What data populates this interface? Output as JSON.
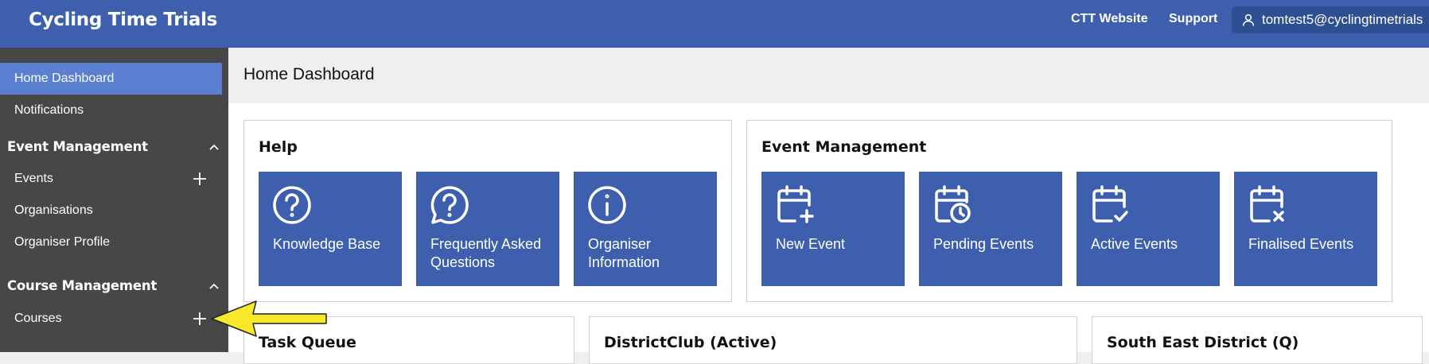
{
  "header": {
    "brand": "Cycling Time Trials",
    "links": [
      "CTT Website",
      "Support"
    ],
    "user_email": "tomtest5@cyclingtimetrials"
  },
  "sidebar": {
    "home": "Home Dashboard",
    "notifications": "Notifications",
    "event_section": {
      "title": "Event Management",
      "items": [
        "Events",
        "Organisations",
        "Organiser Profile"
      ]
    },
    "course_section": {
      "title": "Course Management",
      "items": [
        "Courses"
      ]
    }
  },
  "page": {
    "title": "Home Dashboard"
  },
  "help_panel": {
    "title": "Help",
    "tiles": [
      "Knowledge Base",
      "Frequently Asked Questions",
      "Organiser Information"
    ]
  },
  "event_panel": {
    "title": "Event Management",
    "tiles": [
      "New Event",
      "Pending Events",
      "Active Events",
      "Finalised Events"
    ]
  },
  "lower_panels": [
    "Task Queue",
    "DistrictClub (Active)",
    "South East District (Q)"
  ],
  "colors": {
    "brand": "#3d5fad",
    "sidebar": "#474747",
    "active": "#5b7fd1",
    "annotation": "#f7e82a"
  }
}
